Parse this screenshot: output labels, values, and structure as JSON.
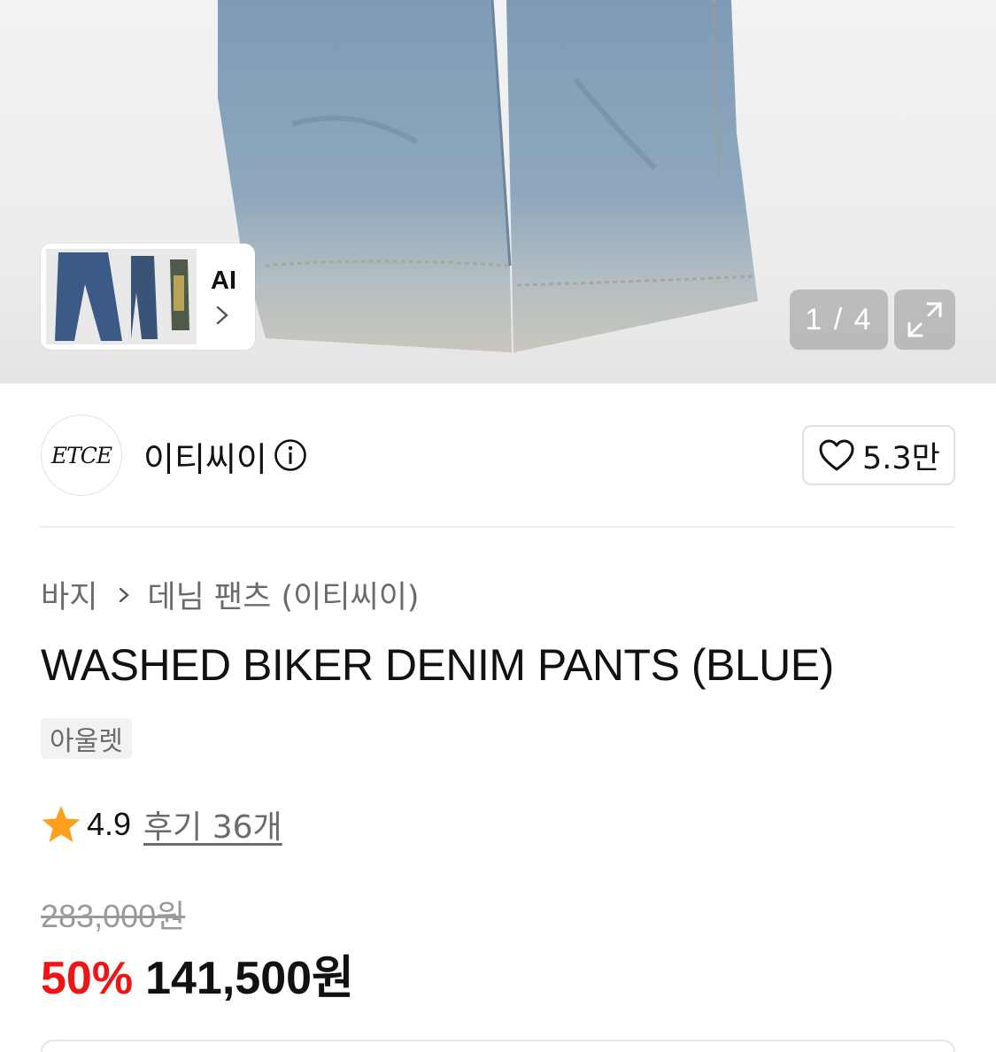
{
  "gallery": {
    "ai_label": "AI",
    "pager": "1 / 4",
    "current_page": 1,
    "total_pages": 4
  },
  "brand": {
    "logo_text": "ETCE",
    "name": "이티씨이",
    "likes": "5.3만"
  },
  "breadcrumb": {
    "category": "바지",
    "subcategory": "데님 팬츠 (이티씨이)"
  },
  "product": {
    "title": "WASHED BIKER DENIM PANTS (BLUE)",
    "tag": "아울렛",
    "rating": "4.9",
    "reviews": "후기 36개",
    "original_price": "283,000원",
    "discount": "50%",
    "final_price": "141,500원"
  },
  "colors": {
    "discount_red": "#f01414",
    "star_orange": "#ff9f1c",
    "denim_blue": "#7f9bb5"
  },
  "icons": [
    "chevron-right-icon",
    "expand-icon",
    "info-icon",
    "heart-icon",
    "star-icon"
  ]
}
